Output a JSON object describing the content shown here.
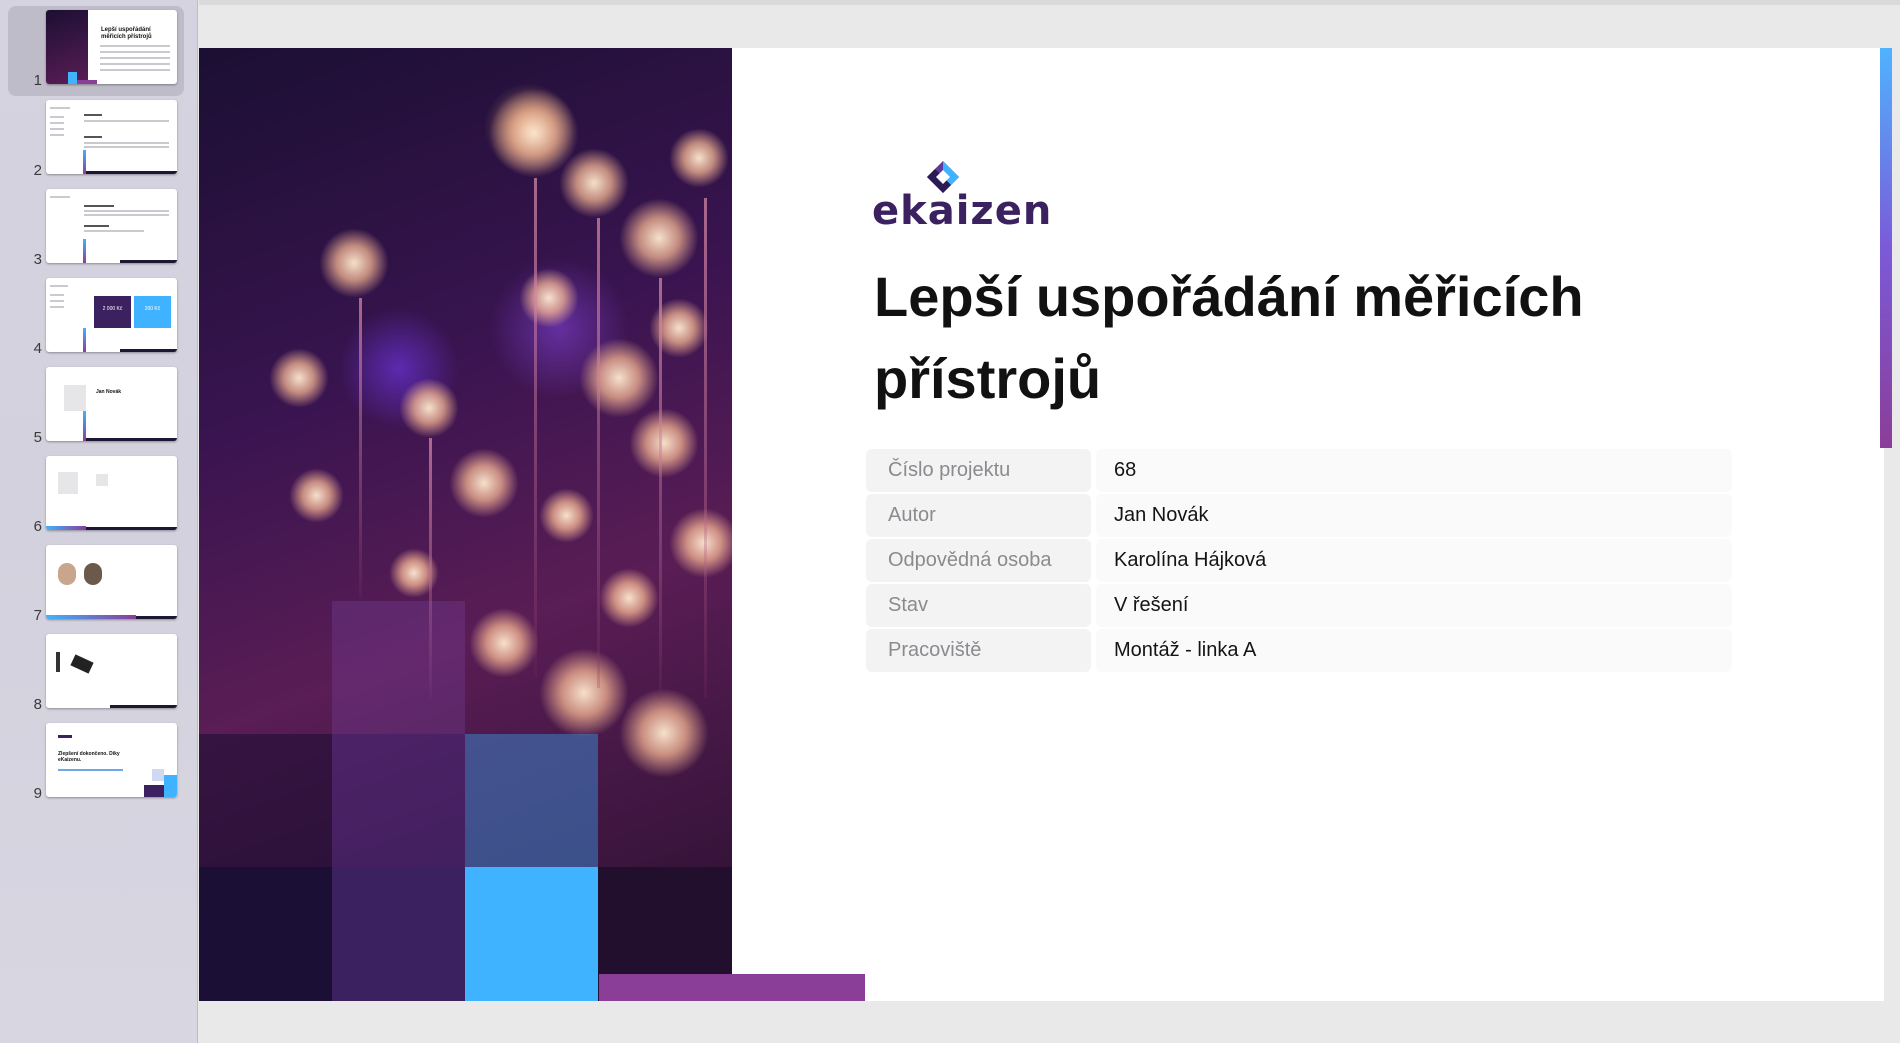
{
  "thumbnails": [
    {
      "num": "1",
      "title": "Lepší uspořádání měřicích přístrojů"
    },
    {
      "num": "2"
    },
    {
      "num": "3"
    },
    {
      "num": "4",
      "values": [
        "2 000 Kč",
        "200 Kč"
      ]
    },
    {
      "num": "5",
      "name": "Jan Novák"
    },
    {
      "num": "6"
    },
    {
      "num": "7"
    },
    {
      "num": "8"
    },
    {
      "num": "9",
      "title": "Zlepšení dokončeno. Díky eKaizenu."
    }
  ],
  "slide": {
    "logo_text": "ekaizen",
    "title": "Lepší uspořádání měřicích přístrojů",
    "info": [
      {
        "label": "Číslo projektu",
        "value": "68"
      },
      {
        "label": "Autor",
        "value": "Jan Novák"
      },
      {
        "label": "Odpovědná osoba",
        "value": "Karolína Hájková"
      },
      {
        "label": "Stav",
        "value": "V řešení"
      },
      {
        "label": "Pracoviště",
        "value": "Montáž - linka A"
      }
    ]
  },
  "colors": {
    "brand_purple": "#3b2160",
    "accent_blue": "#3fb3ff",
    "accent_magenta": "#8b3e97",
    "dark_navy": "#1d1635"
  }
}
